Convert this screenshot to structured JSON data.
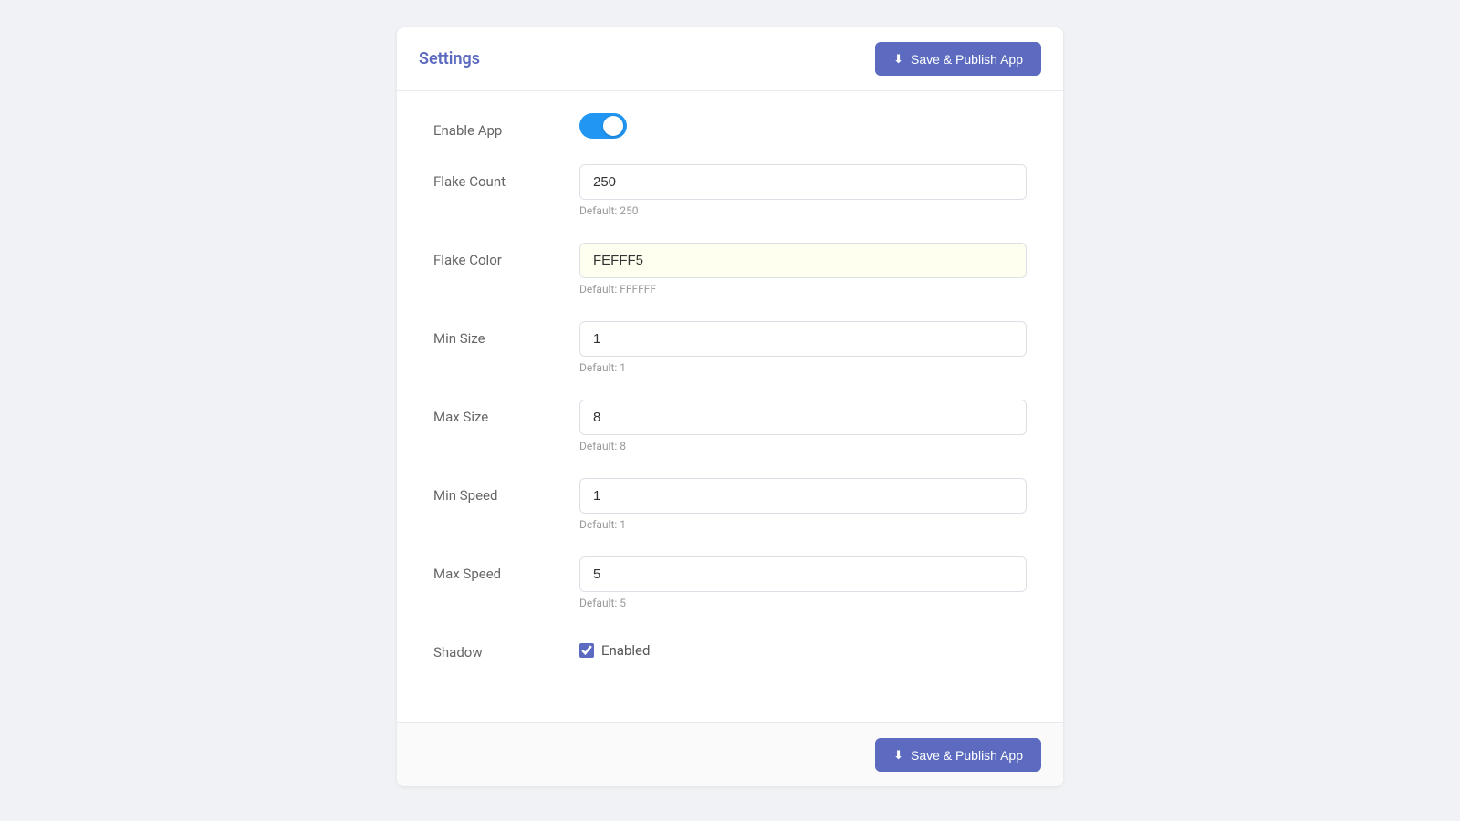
{
  "header": {
    "title": "Settings",
    "publish_button": "Save & Publish App"
  },
  "footer": {
    "publish_button": "Save & Publish App"
  },
  "fields": {
    "enable_app": {
      "label": "Enable App",
      "value": true
    },
    "flake_count": {
      "label": "Flake Count",
      "value": "250",
      "hint": "Default: 250"
    },
    "flake_color": {
      "label": "Flake Color",
      "value": "FEFFF5",
      "hint": "Default: FFFFFF"
    },
    "min_size": {
      "label": "Min Size",
      "value": "1",
      "hint": "Default: 1"
    },
    "max_size": {
      "label": "Max Size",
      "value": "8",
      "hint": "Default: 8"
    },
    "min_speed": {
      "label": "Min Speed",
      "value": "1",
      "hint": "Default: 1"
    },
    "max_speed": {
      "label": "Max Speed",
      "value": "5",
      "hint": "Default: 5"
    },
    "shadow": {
      "label": "Shadow",
      "checkbox_label": "Enabled",
      "checked": true
    }
  }
}
